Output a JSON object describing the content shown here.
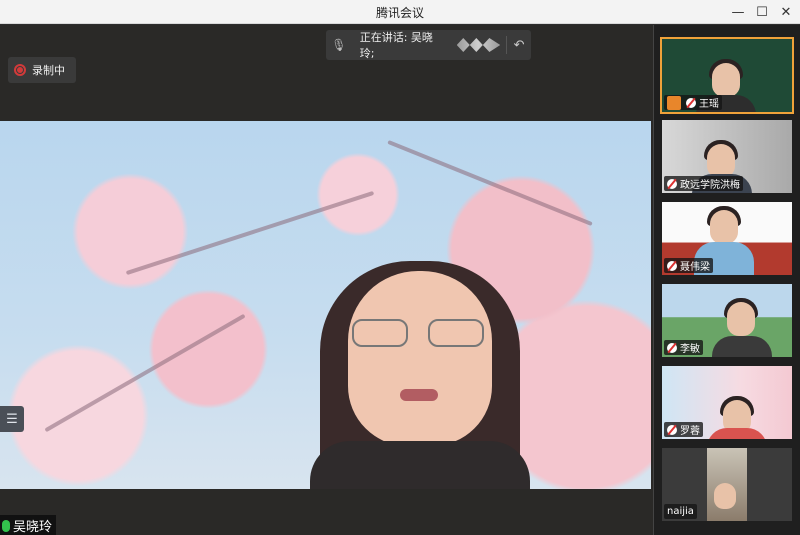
{
  "window": {
    "title": "腾讯会议",
    "minimize_icon": "minimize-icon",
    "maximize_icon": "maximize-icon",
    "close_icon": "close-icon"
  },
  "recording": {
    "label": "录制中"
  },
  "speaking_bar": {
    "text": "正在讲话: 吴晓玲;"
  },
  "main_video": {
    "participant_name": "吴晓玲"
  },
  "participants": [
    {
      "name": "王瑶",
      "host": true,
      "mic_muted": true
    },
    {
      "name": "政远学院洪梅",
      "host": false,
      "mic_muted": true
    },
    {
      "name": "聂伟梁",
      "host": false,
      "mic_muted": true
    },
    {
      "name": "李敏",
      "host": false,
      "mic_muted": true
    },
    {
      "name": "罗蓉",
      "host": false,
      "mic_muted": true
    },
    {
      "name": "naijia",
      "host": false,
      "mic_muted": false
    }
  ],
  "colors": {
    "active_speaker_border": "#f0a23a",
    "recording_red": "#d23a3a",
    "mic_active_green": "#33c24d"
  }
}
